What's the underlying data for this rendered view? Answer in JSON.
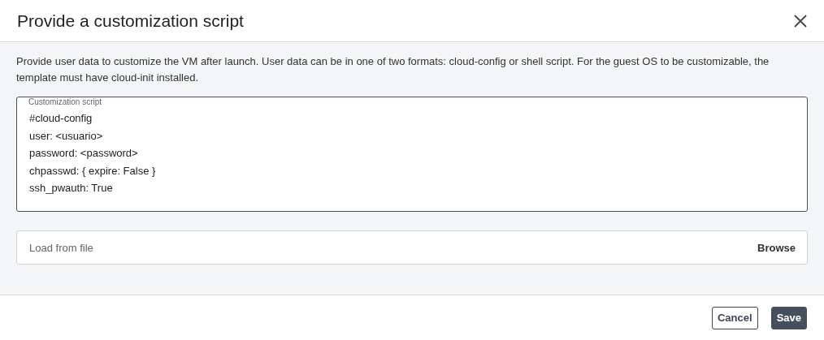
{
  "dialog": {
    "title": "Provide a customization script"
  },
  "description": "Provide user data to customize the VM after launch. User data can be in one of two formats: cloud-config or shell script. For the guest OS to be customizable, the template must have cloud-init installed.",
  "script_field": {
    "label": "Customization script",
    "value": "#cloud-config\nuser: <usuario>\npassword: <password>\nchpasswd: { expire: False }\nssh_pwauth: True"
  },
  "file_field": {
    "placeholder": "Load from file",
    "button": "Browse"
  },
  "buttons": [
    {
      "label": "Cancel",
      "kind": "secondary"
    },
    {
      "label": "Save",
      "kind": "primary"
    }
  ]
}
